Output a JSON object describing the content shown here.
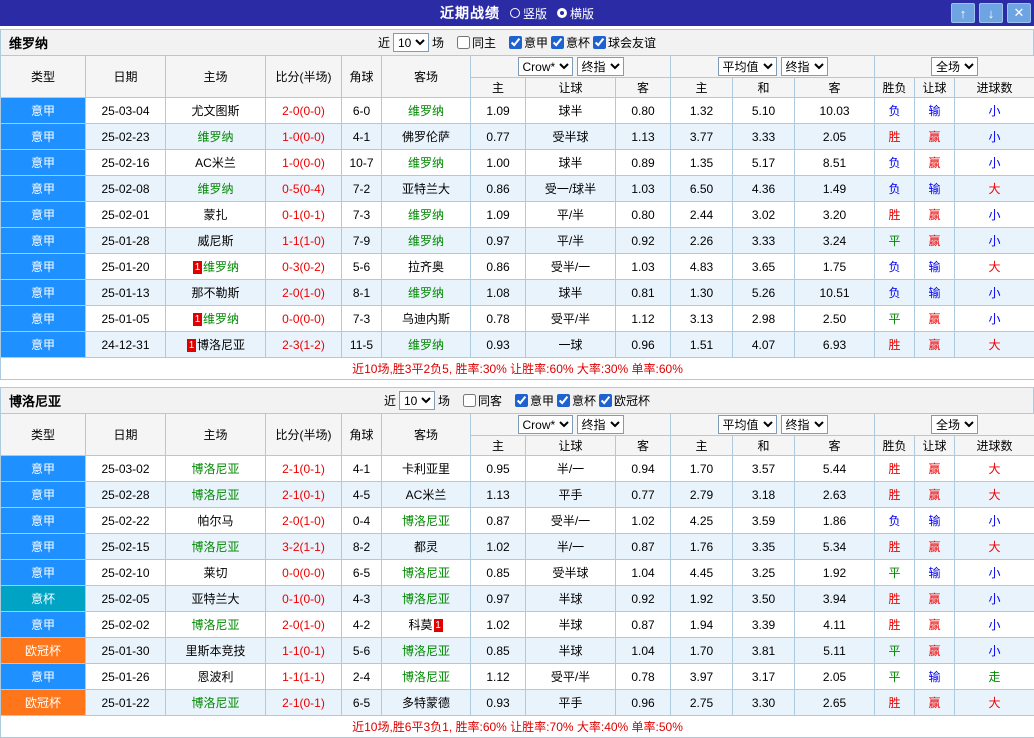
{
  "colors": {
    "titlebar-bg": "#2B2BA6",
    "league-serie-a": "#1E90FF",
    "league-italy-cup": "#00A3C4",
    "league-ucl": "#FF7519",
    "win-red": "#EE0000",
    "draw-green": "#008800",
    "lose-blue": "#0000EE",
    "subject-green": "#008800",
    "score-red": "#EE0000",
    "summary-red": "#DD0000",
    "alt-row": "#E9F3FC",
    "grid-line": "#AECADF"
  },
  "titlebar": {
    "title": "近期战绩",
    "view_options": [
      {
        "label": "竖版",
        "selected": false
      },
      {
        "label": "横版",
        "selected": true
      }
    ],
    "buttons": {
      "up": "↑",
      "down": "↓",
      "close": "✕"
    }
  },
  "sections": [
    {
      "team": "维罗纳",
      "filters": {
        "near": "近",
        "count": "10",
        "games": "场",
        "same": {
          "label": "同主",
          "checked": false
        },
        "leagues": [
          {
            "label": "意甲",
            "checked": true
          },
          {
            "label": "意杯",
            "checked": true
          },
          {
            "label": "球会友谊",
            "checked": true
          }
        ]
      },
      "header": {
        "cols": [
          "类型",
          "日期",
          "主场",
          "比分(半场)",
          "角球",
          "客场"
        ],
        "selects": {
          "book": "Crow*",
          "final_a": "终指",
          "avg": "平均值",
          "final_b": "终指",
          "scope": "全场"
        },
        "sub": [
          "主",
          "让球",
          "客",
          "主",
          "和",
          "客",
          "胜负",
          "让球",
          "进球数"
        ]
      },
      "rows": [
        {
          "league": "意甲",
          "date": "25-03-04",
          "home": "尤文图斯",
          "score": "2-0(0-0)",
          "corner": "6-0",
          "away": "维罗纳",
          "odds_home": "1.09",
          "handicap": "球半",
          "odds_away": "0.80",
          "avg_home": "1.32",
          "avg_draw": "5.10",
          "avg_away": "10.03",
          "result": "负",
          "cover": "输",
          "goals": "小"
        },
        {
          "league": "意甲",
          "date": "25-02-23",
          "home": "维罗纳",
          "score": "1-0(0-0)",
          "corner": "4-1",
          "away": "佛罗伦萨",
          "odds_home": "0.77",
          "handicap": "受半球",
          "odds_away": "1.13",
          "avg_home": "3.77",
          "avg_draw": "3.33",
          "avg_away": "2.05",
          "result": "胜",
          "cover": "赢",
          "goals": "小"
        },
        {
          "league": "意甲",
          "date": "25-02-16",
          "home": "AC米兰",
          "score": "1-0(0-0)",
          "corner": "10-7",
          "away": "维罗纳",
          "odds_home": "1.00",
          "handicap": "球半",
          "odds_away": "0.89",
          "avg_home": "1.35",
          "avg_draw": "5.17",
          "avg_away": "8.51",
          "result": "负",
          "cover": "赢",
          "goals": "小"
        },
        {
          "league": "意甲",
          "date": "25-02-08",
          "home": "维罗纳",
          "score": "0-5(0-4)",
          "corner": "7-2",
          "away": "亚特兰大",
          "odds_home": "0.86",
          "handicap": "受一/球半",
          "odds_away": "1.03",
          "avg_home": "6.50",
          "avg_draw": "4.36",
          "avg_away": "1.49",
          "result": "负",
          "cover": "输",
          "goals": "大"
        },
        {
          "league": "意甲",
          "date": "25-02-01",
          "home": "蒙扎",
          "score": "0-1(0-1)",
          "corner": "7-3",
          "away": "维罗纳",
          "odds_home": "1.09",
          "handicap": "平/半",
          "odds_away": "0.80",
          "avg_home": "2.44",
          "avg_draw": "3.02",
          "avg_away": "3.20",
          "result": "胜",
          "cover": "赢",
          "goals": "小"
        },
        {
          "league": "意甲",
          "date": "25-01-28",
          "home": "威尼斯",
          "score": "1-1(1-0)",
          "corner": "7-9",
          "away": "维罗纳",
          "odds_home": "0.97",
          "handicap": "平/半",
          "odds_away": "0.92",
          "avg_home": "2.26",
          "avg_draw": "3.33",
          "avg_away": "3.24",
          "result": "平",
          "cover": "赢",
          "goals": "小"
        },
        {
          "league": "意甲",
          "date": "25-01-20",
          "home": "维罗纳",
          "home_badge_before": "1",
          "score": "0-3(0-2)",
          "corner": "5-6",
          "away": "拉齐奥",
          "odds_home": "0.86",
          "handicap": "受半/一",
          "odds_away": "1.03",
          "avg_home": "4.83",
          "avg_draw": "3.65",
          "avg_away": "1.75",
          "result": "负",
          "cover": "输",
          "goals": "大"
        },
        {
          "league": "意甲",
          "date": "25-01-13",
          "home": "那不勒斯",
          "score": "2-0(1-0)",
          "corner": "8-1",
          "away": "维罗纳",
          "odds_home": "1.08",
          "handicap": "球半",
          "odds_away": "0.81",
          "avg_home": "1.30",
          "avg_draw": "5.26",
          "avg_away": "10.51",
          "result": "负",
          "cover": "输",
          "goals": "小"
        },
        {
          "league": "意甲",
          "date": "25-01-05",
          "home": "维罗纳",
          "home_badge_before": "1",
          "score": "0-0(0-0)",
          "corner": "7-3",
          "away": "乌迪内斯",
          "odds_home": "0.78",
          "handicap": "受平/半",
          "odds_away": "1.12",
          "avg_home": "3.13",
          "avg_draw": "2.98",
          "avg_away": "2.50",
          "result": "平",
          "cover": "赢",
          "goals": "小"
        },
        {
          "league": "意甲",
          "date": "24-12-31",
          "home": "博洛尼亚",
          "home_badge_before": "1",
          "score": "2-3(1-2)",
          "corner": "11-5",
          "away": "维罗纳",
          "odds_home": "0.93",
          "handicap": "一球",
          "odds_away": "0.96",
          "avg_home": "1.51",
          "avg_draw": "4.07",
          "avg_away": "6.93",
          "result": "胜",
          "cover": "赢",
          "goals": "大"
        }
      ],
      "summary": "近10场,胜3平2负5, 胜率:30% 让胜率:60% 大率:30% 单率:60%"
    },
    {
      "team": "博洛尼亚",
      "filters": {
        "near": "近",
        "count": "10",
        "games": "场",
        "same": {
          "label": "同客",
          "checked": false
        },
        "leagues": [
          {
            "label": "意甲",
            "checked": true
          },
          {
            "label": "意杯",
            "checked": true
          },
          {
            "label": "欧冠杯",
            "checked": true
          }
        ]
      },
      "header": {
        "cols": [
          "类型",
          "日期",
          "主场",
          "比分(半场)",
          "角球",
          "客场"
        ],
        "selects": {
          "book": "Crow*",
          "final_a": "终指",
          "avg": "平均值",
          "final_b": "终指",
          "scope": "全场"
        },
        "sub": [
          "主",
          "让球",
          "客",
          "主",
          "和",
          "客",
          "胜负",
          "让球",
          "进球数"
        ]
      },
      "rows": [
        {
          "league": "意甲",
          "date": "25-03-02",
          "home": "博洛尼亚",
          "score": "2-1(0-1)",
          "corner": "4-1",
          "away": "卡利亚里",
          "odds_home": "0.95",
          "handicap": "半/一",
          "odds_away": "0.94",
          "avg_home": "1.70",
          "avg_draw": "3.57",
          "avg_away": "5.44",
          "result": "胜",
          "cover": "赢",
          "goals": "大"
        },
        {
          "league": "意甲",
          "date": "25-02-28",
          "home": "博洛尼亚",
          "score": "2-1(0-1)",
          "corner": "4-5",
          "away": "AC米兰",
          "odds_home": "1.13",
          "handicap": "平手",
          "odds_away": "0.77",
          "avg_home": "2.79",
          "avg_draw": "3.18",
          "avg_away": "2.63",
          "result": "胜",
          "cover": "赢",
          "goals": "大"
        },
        {
          "league": "意甲",
          "date": "25-02-22",
          "home": "帕尔马",
          "score": "2-0(1-0)",
          "corner": "0-4",
          "away": "博洛尼亚",
          "odds_home": "0.87",
          "handicap": "受半/一",
          "odds_away": "1.02",
          "avg_home": "4.25",
          "avg_draw": "3.59",
          "avg_away": "1.86",
          "result": "负",
          "cover": "输",
          "goals": "小"
        },
        {
          "league": "意甲",
          "date": "25-02-15",
          "home": "博洛尼亚",
          "score": "3-2(1-1)",
          "corner": "8-2",
          "away": "都灵",
          "odds_home": "1.02",
          "handicap": "半/一",
          "odds_away": "0.87",
          "avg_home": "1.76",
          "avg_draw": "3.35",
          "avg_away": "5.34",
          "result": "胜",
          "cover": "赢",
          "goals": "大"
        },
        {
          "league": "意甲",
          "date": "25-02-10",
          "home": "莱切",
          "score": "0-0(0-0)",
          "corner": "6-5",
          "away": "博洛尼亚",
          "odds_home": "0.85",
          "handicap": "受半球",
          "odds_away": "1.04",
          "avg_home": "4.45",
          "avg_draw": "3.25",
          "avg_away": "1.92",
          "result": "平",
          "cover": "输",
          "goals": "小"
        },
        {
          "league": "意杯",
          "date": "25-02-05",
          "home": "亚特兰大",
          "score": "0-1(0-0)",
          "corner": "4-3",
          "away": "博洛尼亚",
          "odds_home": "0.97",
          "handicap": "半球",
          "odds_away": "0.92",
          "avg_home": "1.92",
          "avg_draw": "3.50",
          "avg_away": "3.94",
          "result": "胜",
          "cover": "赢",
          "goals": "小"
        },
        {
          "league": "意甲",
          "date": "25-02-02",
          "home": "博洛尼亚",
          "score": "2-0(1-0)",
          "corner": "4-2",
          "away": "科莫",
          "away_badge_after": "1",
          "odds_home": "1.02",
          "handicap": "半球",
          "odds_away": "0.87",
          "avg_home": "1.94",
          "avg_draw": "3.39",
          "avg_away": "4.11",
          "result": "胜",
          "cover": "赢",
          "goals": "小"
        },
        {
          "league": "欧冠杯",
          "date": "25-01-30",
          "home": "里斯本竞技",
          "score": "1-1(0-1)",
          "corner": "5-6",
          "away": "博洛尼亚",
          "odds_home": "0.85",
          "handicap": "半球",
          "odds_away": "1.04",
          "avg_home": "1.70",
          "avg_draw": "3.81",
          "avg_away": "5.11",
          "result": "平",
          "cover": "赢",
          "goals": "小"
        },
        {
          "league": "意甲",
          "date": "25-01-26",
          "home": "恩波利",
          "score": "1-1(1-1)",
          "corner": "2-4",
          "away": "博洛尼亚",
          "odds_home": "1.12",
          "handicap": "受平/半",
          "odds_away": "0.78",
          "avg_home": "3.97",
          "avg_draw": "3.17",
          "avg_away": "2.05",
          "result": "平",
          "cover": "输",
          "goals": "走"
        },
        {
          "league": "欧冠杯",
          "date": "25-01-22",
          "home": "博洛尼亚",
          "score": "2-1(0-1)",
          "corner": "6-5",
          "away": "多特蒙德",
          "odds_home": "0.93",
          "handicap": "平手",
          "odds_away": "0.96",
          "avg_home": "2.75",
          "avg_draw": "3.30",
          "avg_away": "2.65",
          "result": "胜",
          "cover": "赢",
          "goals": "大"
        }
      ],
      "summary": "近10场,胜6平3负1, 胜率:60% 让胜率:70% 大率:40% 单率:50%"
    }
  ]
}
